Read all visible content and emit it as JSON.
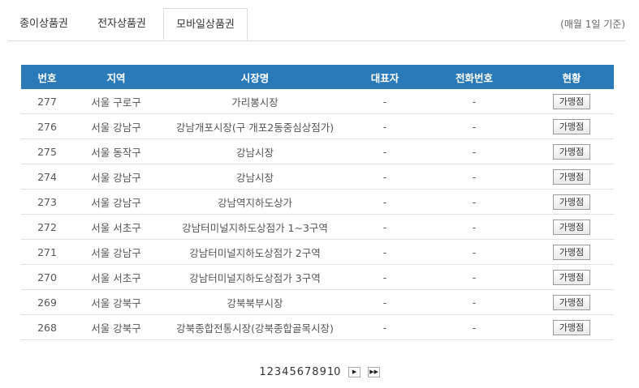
{
  "tabs": [
    "종이상품권",
    "전자상품권",
    "모바일상품권"
  ],
  "note": "(매월 1일 기준)",
  "columns": [
    "번호",
    "지역",
    "시장명",
    "대표자",
    "전화번호",
    "현황"
  ],
  "rows": [
    {
      "no": "277",
      "region": "서울 구로구",
      "market": "가리봉시장",
      "rep": "-",
      "phone": "-",
      "status": "가맹점"
    },
    {
      "no": "276",
      "region": "서울 강남구",
      "market": "강남개포시장(구 개포2동중심상점가)",
      "rep": "-",
      "phone": "-",
      "status": "가맹점"
    },
    {
      "no": "275",
      "region": "서울 동작구",
      "market": "강남시장",
      "rep": "-",
      "phone": "-",
      "status": "가맹점"
    },
    {
      "no": "274",
      "region": "서울 강남구",
      "market": "강남시장",
      "rep": "-",
      "phone": "-",
      "status": "가맹점"
    },
    {
      "no": "273",
      "region": "서울 강남구",
      "market": "강남역지하도상가",
      "rep": "-",
      "phone": "-",
      "status": "가맹점"
    },
    {
      "no": "272",
      "region": "서울 서초구",
      "market": "강남터미널지하도상점가 1~3구역",
      "rep": "-",
      "phone": "-",
      "status": "가맹점"
    },
    {
      "no": "271",
      "region": "서울 강남구",
      "market": "강남터미널지하도상점가 2구역",
      "rep": "-",
      "phone": "-",
      "status": "가맹점"
    },
    {
      "no": "270",
      "region": "서울 서초구",
      "market": "강남터미널지하도상점가 3구역",
      "rep": "-",
      "phone": "-",
      "status": "가맹점"
    },
    {
      "no": "269",
      "region": "서울 강북구",
      "market": "강북북부시장",
      "rep": "-",
      "phone": "-",
      "status": "가맹점"
    },
    {
      "no": "268",
      "region": "서울 강북구",
      "market": "강북종합전통시장(강북종합골목시장)",
      "rep": "-",
      "phone": "-",
      "status": "가맹점"
    }
  ],
  "pagination": {
    "pages": [
      "1",
      "2",
      "3",
      "4",
      "5",
      "6",
      "7",
      "8",
      "9",
      "10"
    ],
    "next_icon": "▶",
    "last_icon": "▶▶"
  }
}
